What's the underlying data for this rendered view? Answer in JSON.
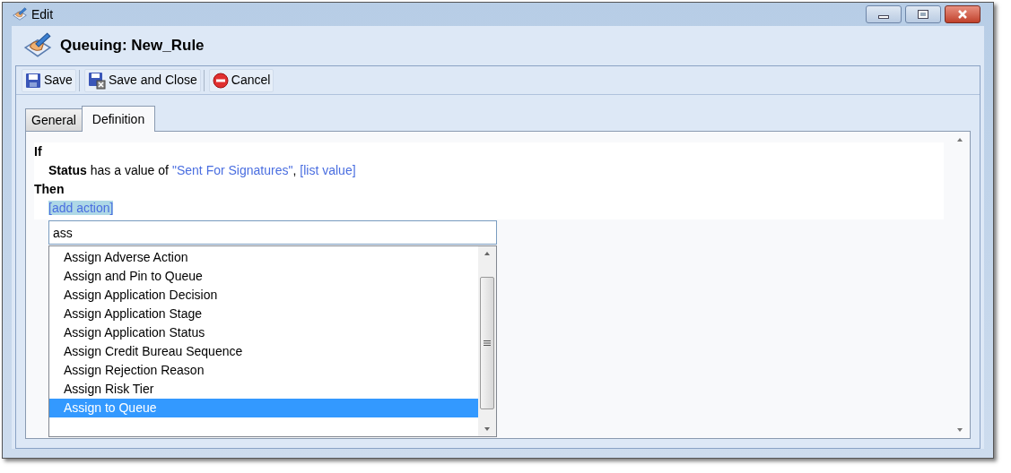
{
  "window": {
    "title": "Edit"
  },
  "header": {
    "title": "Queuing: New_Rule"
  },
  "toolbar": [
    {
      "kind": "save",
      "label": "Save"
    },
    {
      "kind": "save-close",
      "label": "Save and Close"
    },
    {
      "kind": "cancel",
      "label": "Cancel"
    }
  ],
  "tabs": [
    {
      "label": "General",
      "selected": false
    },
    {
      "label": "Definition",
      "selected": true
    }
  ],
  "rule": {
    "if_label": "If",
    "condition": {
      "field": "Status",
      "text": "has a value of",
      "value": "\"Sent For Signatures\"",
      "separator": ",",
      "link": "[list value]"
    },
    "then_label": "Then",
    "add_action": "[add action]"
  },
  "search": {
    "value": "ass"
  },
  "options": [
    {
      "label": "Assign Adverse Action",
      "selected": false
    },
    {
      "label": "Assign and Pin to Queue",
      "selected": false
    },
    {
      "label": "Assign Application Decision",
      "selected": false
    },
    {
      "label": "Assign Application Stage",
      "selected": false
    },
    {
      "label": "Assign Application Status",
      "selected": false
    },
    {
      "label": "Assign Credit Bureau Sequence",
      "selected": false
    },
    {
      "label": "Assign Rejection Reason",
      "selected": false
    },
    {
      "label": "Assign Risk Tier",
      "selected": false
    },
    {
      "label": "Assign to Queue",
      "selected": true
    }
  ]
}
